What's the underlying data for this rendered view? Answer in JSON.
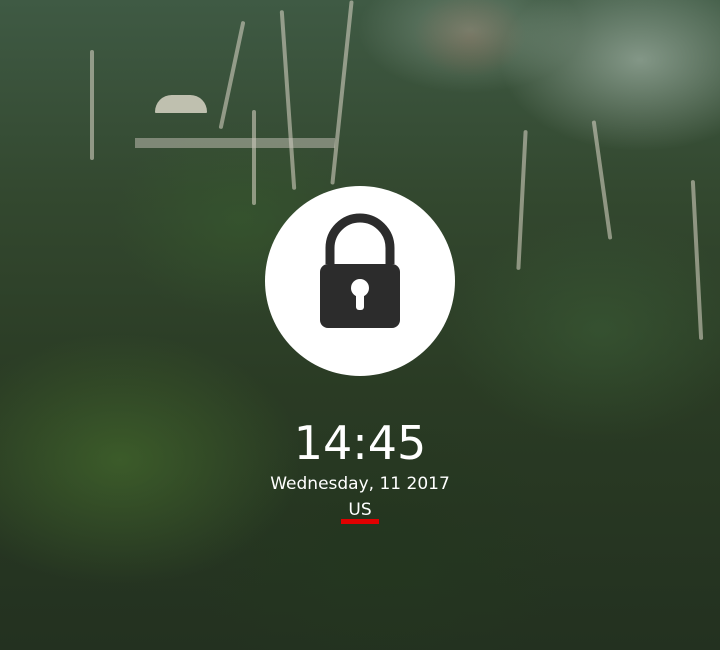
{
  "lockscreen": {
    "time": "14:45",
    "date": "Wednesday, 11 2017",
    "keyboard_layout": "US",
    "lock_icon": "padlock-icon",
    "underline_color": "#e00000"
  }
}
